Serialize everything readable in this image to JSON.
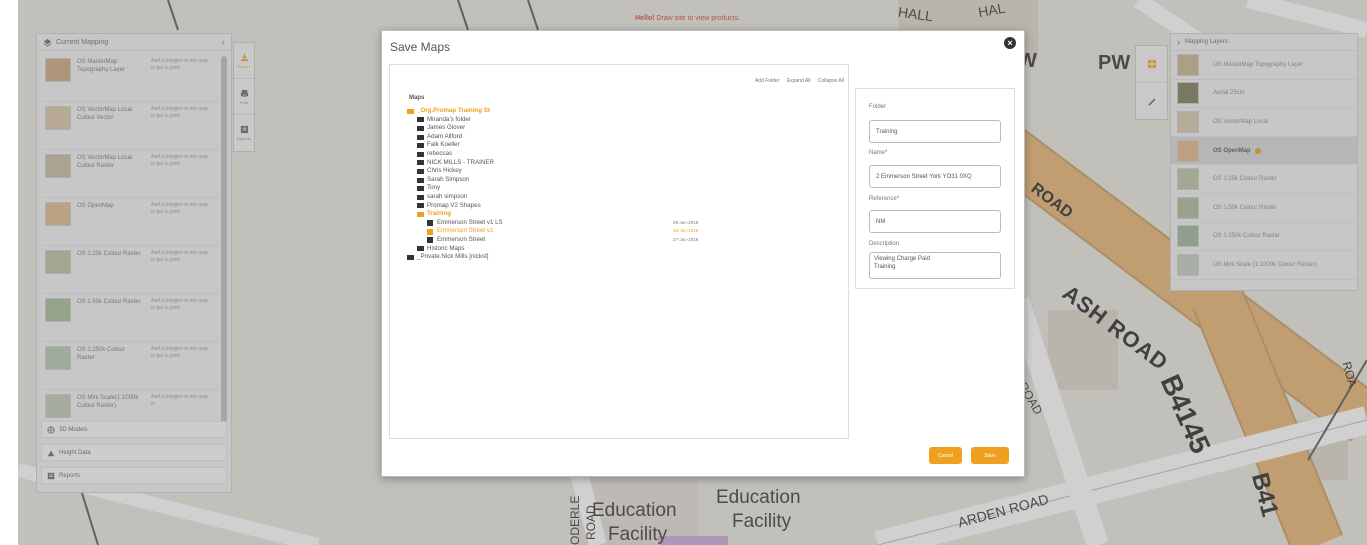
{
  "banner": {
    "prefix": "Hello!",
    "text": " Draw site to view products."
  },
  "map_labels": {
    "ash_road": "ASH ROAD",
    "b4145": "B4145",
    "b4145_b": "B41",
    "arden_road": "ARDEN ROAD",
    "education_1": "Education",
    "facility_1": "Facility",
    "education_2": "Education",
    "facility_2": "Facility",
    "pw": "PW",
    "w": "W",
    "oderle": "ODERLE",
    "road_small": "ROAD",
    "road_mid": "ROAD",
    "road_right": "ROAD",
    "rd_right": "ROA",
    "hall": "HALL",
    "hal": "HAL"
  },
  "left_panel": {
    "title": "Current Mapping",
    "layers": [
      {
        "name": "OS MasterMap Topography Layer",
        "hint": "Add a polygon to the map to get a price",
        "color": "#c9a77a"
      },
      {
        "name": "OS VectorMap Local Colour Vector",
        "hint": "Add a polygon to the map to get a price",
        "color": "#d9c3a5"
      },
      {
        "name": "OS VectorMap Local Colour Raster",
        "hint": "Add a polygon to the map to get a price",
        "color": "#c7b8a0"
      },
      {
        "name": "OS OpenMap",
        "hint": "Add a polygon to the map to get a price",
        "color": "#e0b98a"
      },
      {
        "name": "OS 1:25k Colour Raster",
        "hint": "Add a polygon to the map to get a price",
        "color": "#b8c0a0"
      },
      {
        "name": "OS 1:50k Colour Raster",
        "hint": "Add a polygon to the map to get a price",
        "color": "#a8b895"
      },
      {
        "name": "OS 1:250k Colour Raster",
        "hint": "Add a polygon to the map to get a price",
        "color": "#b6c6b0"
      },
      {
        "name": "OS Mini Scale(1:1000k Colour Raster)",
        "hint": "Add a polygon to the map to",
        "color": "#c0c8b8"
      }
    ],
    "sections": [
      "3D Models",
      "Height Data",
      "Reports"
    ]
  },
  "tool_strip": {
    "tools": [
      "Export",
      "Print",
      "Reports"
    ]
  },
  "right_panel": {
    "title": "Mapping Layers",
    "items": [
      {
        "label": "OS MasterMap Topography Layer",
        "active": false,
        "color": "#c6b48e"
      },
      {
        "label": "Aerial 25cm",
        "active": false,
        "color": "#7a7a55"
      },
      {
        "label": "OS VectorMap Local",
        "active": false,
        "color": "#d6c8ae"
      },
      {
        "label": "OS OpenMap",
        "active": true,
        "color": "#e4b585"
      },
      {
        "label": "OS 1:25k Colour Raster",
        "active": false,
        "color": "#b8c2a2"
      },
      {
        "label": "OS 1:50k Colour Raster",
        "active": false,
        "color": "#aab895"
      },
      {
        "label": "OS 1:250k Colour Raster",
        "active": false,
        "color": "#98b298"
      },
      {
        "label": "OS Mini Scale (1:1000k Colour Raster)",
        "active": false,
        "color": "#c4cbbe"
      }
    ]
  },
  "dialog": {
    "title": "Save Maps",
    "close_label": "×",
    "toolbar": {
      "add_folder": "Add Folder",
      "expand_all": "Expand All",
      "collapse_all": "Collapse All"
    },
    "tree_root": "Maps",
    "tree": [
      {
        "label": "_Org.Promap Training St",
        "type": "folder",
        "level": 0,
        "orange": true,
        "bold": true,
        "date": ""
      },
      {
        "label": "Miranda&rsquo;s folder",
        "type": "folder",
        "level": 1,
        "orange": false,
        "bold": false,
        "date": ""
      },
      {
        "label": "James Glover",
        "type": "folder",
        "level": 1,
        "orange": false,
        "bold": false,
        "date": ""
      },
      {
        "label": "Adam Allford",
        "type": "folder",
        "level": 1,
        "orange": false,
        "bold": false,
        "date": ""
      },
      {
        "label": "Falk Koeller",
        "type": "folder",
        "level": 1,
        "orange": false,
        "bold": false,
        "date": ""
      },
      {
        "label": "rebeccas",
        "type": "folder",
        "level": 1,
        "orange": false,
        "bold": false,
        "date": ""
      },
      {
        "label": "NICK MILLS - TRAINER",
        "type": "folder",
        "level": 1,
        "orange": false,
        "bold": false,
        "date": ""
      },
      {
        "label": "Chris Hickey",
        "type": "folder",
        "level": 1,
        "orange": false,
        "bold": false,
        "date": ""
      },
      {
        "label": "Sarah Simpson",
        "type": "folder",
        "level": 1,
        "orange": false,
        "bold": false,
        "date": ""
      },
      {
        "label": "Tony",
        "type": "folder",
        "level": 1,
        "orange": false,
        "bold": false,
        "date": ""
      },
      {
        "label": "sarah simpson",
        "type": "folder",
        "level": 1,
        "orange": false,
        "bold": false,
        "date": ""
      },
      {
        "label": "Promap V2 Shapes",
        "type": "folder",
        "level": 1,
        "orange": false,
        "bold": false,
        "date": ""
      },
      {
        "label": "Training",
        "type": "folder",
        "level": 1,
        "orange": true,
        "bold": true,
        "date": ""
      },
      {
        "label": "Emmerson Street v1 LS",
        "type": "map",
        "level": 2,
        "orange": false,
        "bold": false,
        "date": "29-Jun-2018"
      },
      {
        "label": "Emmerson Street v1",
        "type": "map",
        "level": 2,
        "orange": true,
        "bold": false,
        "date": "28-Jun-2018"
      },
      {
        "label": "Emmerson Street",
        "type": "map",
        "level": 2,
        "orange": false,
        "bold": false,
        "date": "27-Jun-2018"
      },
      {
        "label": "Historic Maps",
        "type": "folder",
        "level": 1,
        "orange": false,
        "bold": false,
        "date": ""
      },
      {
        "label": "_Private.Nick Mills [nickst]",
        "type": "folder",
        "level": 0,
        "orange": false,
        "bold": false,
        "date": ""
      }
    ],
    "form": {
      "folder_label": "Folder",
      "folder_value": "Training",
      "name_label": "Name",
      "name_value": "2 Emmerson Street York YO31 0XQ",
      "reference_label": "Reference",
      "reference_value": "NM",
      "description_label": "Description",
      "description_line1": "Viewing Charge Paid",
      "description_line2": "Training",
      "required_mark": "*"
    },
    "buttons": {
      "cancel": "Cancel",
      "save": "Save"
    }
  },
  "colors": {
    "accent": "#f0a020",
    "road": "#e9b26d",
    "map_bg": "#e9e6de"
  }
}
